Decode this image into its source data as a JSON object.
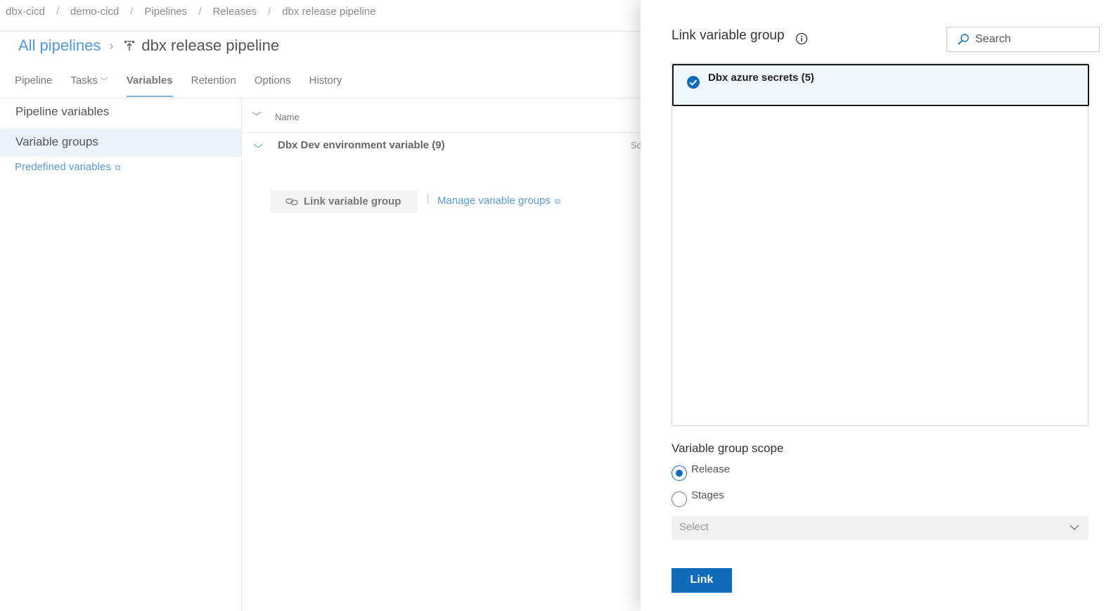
{
  "breadcrumb": [
    "dbx-cicd",
    "demo-cicd",
    "Pipelines",
    "Releases",
    "dbx release pipeline"
  ],
  "header": {
    "all_pipelines": "All pipelines",
    "pipeline_name": "dbx release pipeline"
  },
  "tabs": {
    "pipeline": "Pipeline",
    "tasks": "Tasks",
    "variables": "Variables",
    "retention": "Retention",
    "options": "Options",
    "history": "History",
    "active": "Variables"
  },
  "leftnav": {
    "pipeline_variables": "Pipeline variables",
    "variable_groups": "Variable groups",
    "predefined_variables": "Predefined variables"
  },
  "content": {
    "column_name": "Name",
    "column_scope_partial": "Sc",
    "group_name": "Dbx Dev environment variable (9)",
    "link_button": "Link variable group",
    "manage_link": "Manage variable groups"
  },
  "panel": {
    "title": "Link variable group",
    "search_placeholder": "Search",
    "items": [
      {
        "label": "Dbx azure secrets (5)",
        "selected": true
      }
    ],
    "scope_label": "Variable group scope",
    "scope_options": [
      "Release",
      "Stages"
    ],
    "scope_selected": "Release",
    "stages_select_placeholder": "Select",
    "link_button": "Link"
  },
  "colors": {
    "accent": "#0f6cbd",
    "link": "#5a9bd3",
    "selected_bg": "#eff6fc"
  }
}
